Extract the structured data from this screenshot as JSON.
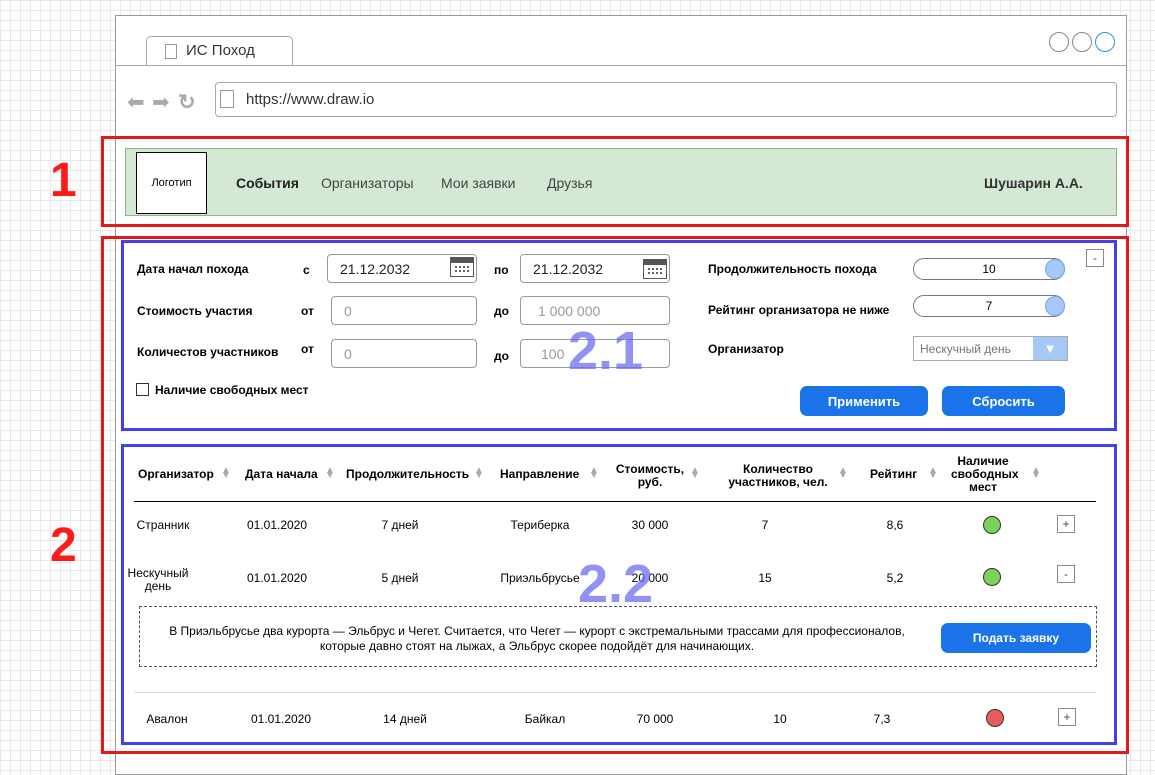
{
  "browser": {
    "tab_title": "ИС Поход",
    "url": "https://www.draw.io"
  },
  "annotations": {
    "section_1": "1",
    "section_2": "2",
    "overlay_2_1": "2.1",
    "overlay_2_2": "2.2"
  },
  "header": {
    "logo": "Логотип",
    "nav": [
      "События",
      "Организаторы",
      "Мои заявки",
      "Друзья"
    ],
    "user": "Шушарин А.А."
  },
  "filters": {
    "date_label": "Дата начал похода",
    "date_from_prefix": "с",
    "date_from": "21.12.2032",
    "date_to_prefix": "по",
    "date_to": "21.12.2032",
    "cost_label": "Стоимость участия",
    "cost_from_prefix": "от",
    "cost_from_placeholder": "0",
    "cost_to_prefix": "до",
    "cost_to_placeholder": "1 000 000",
    "participants_label": "Количестов участников",
    "participants_from_prefix": "от",
    "participants_from_placeholder": "0",
    "participants_to_prefix": "до",
    "participants_to_placeholder": "100",
    "free_places_label": "Наличие свободных мест",
    "duration_label": "Продолжительность похода",
    "duration_value": "10",
    "rating_label": "Рейтинг организатора не ниже",
    "rating_value": "7",
    "organizer_label": "Организатор",
    "organizer_value": "Нескучный день",
    "apply_button": "Применить",
    "reset_button": "Сбросить",
    "collapse_button": "-"
  },
  "table": {
    "columns": [
      "Организатор",
      "Дата начала",
      "Продолжительность",
      "Направление",
      "Стоимость, руб.",
      "Количество участников, чел.",
      "Рейтинг",
      "Наличие свободных мест"
    ],
    "rows": [
      {
        "organizer": "Странник",
        "date": "01.01.2020",
        "duration": "7 дней",
        "direction": "Териберка",
        "cost": "30 000",
        "participants": "7",
        "rating": "8,6",
        "free_color": "#7dd25a",
        "toggle": "+"
      },
      {
        "organizer": "Нескучный день",
        "date": "01.01.2020",
        "duration": "5 дней",
        "direction": "Приэльбрусье",
        "cost": "20 000",
        "participants": "15",
        "rating": "5,2",
        "free_color": "#7dd25a",
        "toggle": "-"
      },
      {
        "organizer": "Авалон",
        "date": "01.01.2020",
        "duration": "14 дней",
        "direction": "Байкал",
        "cost": "70 000",
        "participants": "10",
        "rating": "7,3",
        "free_color": "#e85c5c",
        "toggle": "+"
      }
    ],
    "expanded_text": "В Приэльбрусье два курорта — Эльбрус и Чегет. Считается, что Чегет — курорт с экстремальными трассами для профессионалов, которые давно стоят на лыжах, а Эльбрус скорее подойдёт для начинающих.",
    "apply_request_button": "Подать заявку"
  }
}
